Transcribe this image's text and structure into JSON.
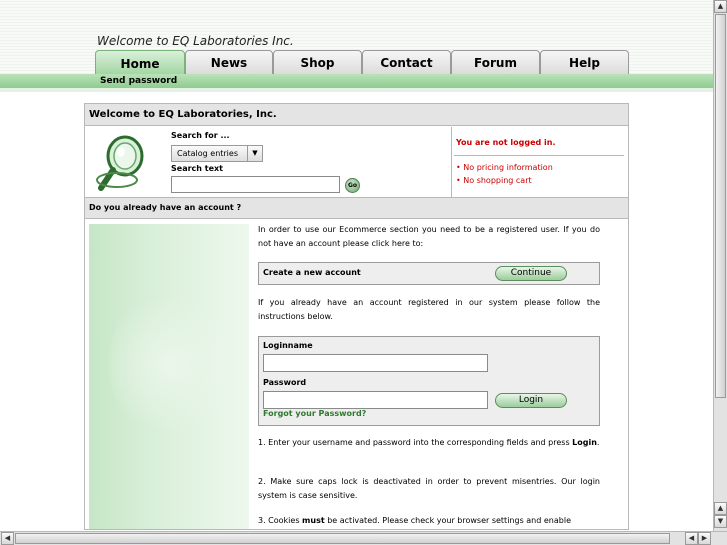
{
  "header": {
    "welcome": "Welcome to EQ Laboratories Inc.",
    "tabs": [
      {
        "label": "Home",
        "active": true
      },
      {
        "label": "News"
      },
      {
        "label": "Shop"
      },
      {
        "label": "Contact"
      },
      {
        "label": "Forum"
      },
      {
        "label": "Help"
      }
    ],
    "subnav_link": "Send password"
  },
  "panel": {
    "title": "Welcome to EQ Laboratories, Inc.",
    "search": {
      "search_for_label": "Search for ...",
      "select_value": "Catalog entries",
      "search_text_label": "Search text",
      "search_text_value": "",
      "go_label": "Go"
    },
    "status": {
      "title": "You are not logged in.",
      "items": [
        "No pricing information",
        "No shopping cart"
      ]
    },
    "account_question": "Do you already have an account ?",
    "intro": "In order to use our Ecommerce section you need to be a registered user. If you do not have an account please click here to:",
    "create": {
      "label": "Create a new account",
      "button": "Continue"
    },
    "existing": "If you already have an account registered in our system please follow the instructions below.",
    "login": {
      "loginname_label": "Loginname",
      "loginname_value": "",
      "password_label": "Password",
      "password_value": "",
      "button": "Login",
      "forgot": "Forgot your Password?"
    },
    "instructions": [
      {
        "pre": "1. Enter your username and password into the corresponding fields and press ",
        "bold": "Login",
        "post": "."
      },
      {
        "pre": "2. Make sure caps lock is deactivated in order to prevent misentries. Our login system is case sensitive.",
        "bold": "",
        "post": ""
      },
      {
        "pre": "3. Cookies ",
        "bold": "must",
        "post": " be activated. Please check your browser settings and enable"
      }
    ]
  },
  "icons": {
    "logo": "magnifier-logo-icon",
    "scroll_up": "arrow-up-icon",
    "scroll_down": "arrow-down-icon",
    "scroll_left": "arrow-left-icon",
    "scroll_right": "arrow-right-icon"
  },
  "colors": {
    "accent_green": "#9fd49f",
    "status_red": "#cc0000",
    "link_green": "#2f7a2f"
  }
}
